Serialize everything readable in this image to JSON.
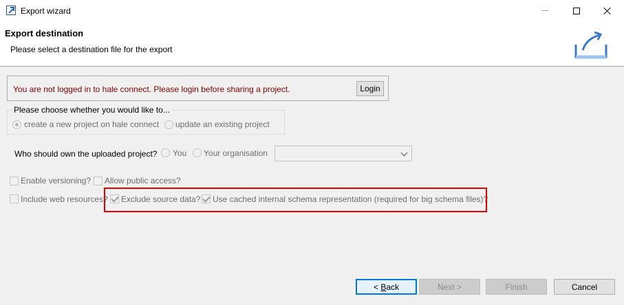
{
  "window": {
    "title": "Export wizard"
  },
  "header": {
    "title": "Export destination",
    "description": "Please select a destination file for the export"
  },
  "login": {
    "message": "You are not logged in to hale connect. Please login before sharing a project.",
    "button_label": "Login"
  },
  "project_choice": {
    "legend": "Please choose whether you would like to...",
    "options": [
      {
        "label": "create a new project on hale connect",
        "selected": true
      },
      {
        "label": "update an existing project",
        "selected": false
      }
    ]
  },
  "owner": {
    "label": "Who should own the uploaded project?",
    "options": [
      {
        "label": "You",
        "selected": false
      },
      {
        "label": "Your organisation",
        "selected": false
      }
    ],
    "dropdown_value": ""
  },
  "options": {
    "enable_versioning": {
      "label": "Enable versioning?",
      "checked": false
    },
    "allow_public_access": {
      "label": "Allow public access?",
      "checked": false
    },
    "include_web_resources": {
      "label": "Include web resources?",
      "checked": false
    },
    "exclude_source_data": {
      "label": "Exclude source data?",
      "checked": true
    },
    "use_cached_schema": {
      "label": "Use cached internal schema representation (required for big schema files)?",
      "checked": true
    }
  },
  "footer": {
    "back_prefix": "< ",
    "back_mnemonic": "B",
    "back_rest": "ack",
    "next_label": "Next >",
    "finish_label": "Finish",
    "cancel_label": "Cancel"
  },
  "colors": {
    "error_text": "#800000",
    "highlight_border": "#e00000",
    "default_button_border": "#0078d7"
  }
}
